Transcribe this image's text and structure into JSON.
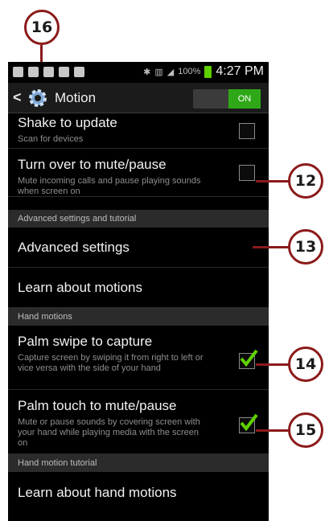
{
  "callouts": {
    "c16": "16",
    "c12": "12",
    "c13": "13",
    "c14": "14",
    "c15": "15"
  },
  "status_bar": {
    "battery_text": "100%",
    "time": "4:27 PM"
  },
  "action_bar": {
    "title": "Motion",
    "toggle_label": "ON"
  },
  "settings": {
    "shake": {
      "title": "Shake to update",
      "subtitle": "Scan for devices",
      "checked": false
    },
    "turn_over": {
      "title": "Turn over to mute/pause",
      "subtitle": "Mute incoming calls and pause playing sounds when screen on",
      "checked": false
    },
    "section_advanced": "Advanced settings and tutorial",
    "advanced_settings": "Advanced settings",
    "learn_motions": "Learn about motions",
    "section_hand": "Hand motions",
    "palm_swipe": {
      "title": "Palm swipe to capture",
      "subtitle": "Capture screen by swiping it from right to left or vice versa with the side of your hand",
      "checked": true
    },
    "palm_touch": {
      "title": "Palm touch to mute/pause",
      "subtitle": "Mute or pause sounds by covering screen with your hand while playing media with the screen on",
      "checked": true
    },
    "section_tutorial": "Hand motion tutorial",
    "learn_hand_motions": "Learn about hand motions"
  },
  "colors": {
    "callout_border": "#8b1a1a",
    "toggle_on": "#2fa818",
    "check_green": "#5fd000"
  }
}
